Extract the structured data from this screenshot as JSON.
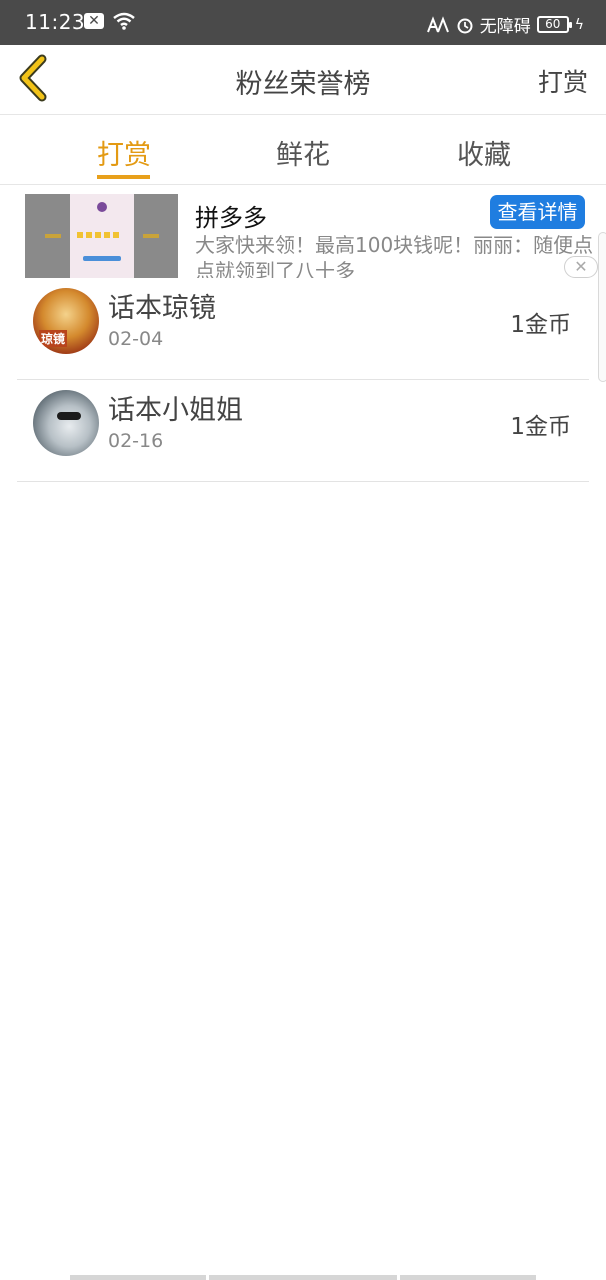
{
  "status_bar": {
    "time": "11:23",
    "accessibility": "无障碍",
    "battery": "60"
  },
  "nav": {
    "title": "粉丝荣誉榜",
    "action": "打赏"
  },
  "tabs": [
    {
      "label": "打赏",
      "active": true
    },
    {
      "label": "鲜花",
      "active": false
    },
    {
      "label": "收藏",
      "active": false
    }
  ],
  "ad": {
    "title": "拼多多",
    "button": "查看详情",
    "description": "大家快来领！最高100块钱呢！丽丽：随便点点就领到了八十多"
  },
  "list": [
    {
      "name": "话本琼镜",
      "date": "02-04",
      "amount": "1金币",
      "avatar_text": "琼镜"
    },
    {
      "name": "话本小姐姐",
      "date": "02-16",
      "amount": "1金币"
    }
  ],
  "colors": {
    "accent": "#e39a13",
    "ad_button": "#1f7de0",
    "status_bar": "#4a4a4a"
  }
}
